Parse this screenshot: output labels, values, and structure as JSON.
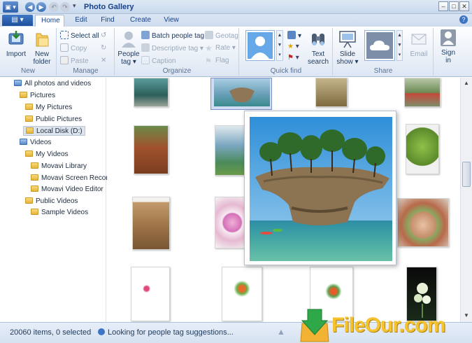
{
  "window": {
    "title": "Photo Gallery"
  },
  "tabs": [
    {
      "label": "Home",
      "active": true
    },
    {
      "label": "Edit"
    },
    {
      "label": "Find"
    },
    {
      "label": "Create"
    },
    {
      "label": "View"
    }
  ],
  "ribbon": {
    "new": {
      "import": "Import",
      "new_folder_1": "New",
      "new_folder_2": "folder",
      "label": "New"
    },
    "manage": {
      "select_all": "Select all",
      "copy": "Copy",
      "paste": "Paste",
      "label": "Manage"
    },
    "organize": {
      "people_tag_1": "People",
      "people_tag_2": "tag ▾",
      "batch_people_tag": "Batch people tag",
      "descriptive_tag": "Descriptive tag ▾",
      "caption": "Caption",
      "geotag": "Geotag",
      "rate": "Rate ▾",
      "flag": "Flag",
      "label": "Organize"
    },
    "quickfind": {
      "text_search_1": "Text",
      "text_search_2": "search",
      "label": "Quick find"
    },
    "share": {
      "slide_show_1": "Slide",
      "slide_show_2": "show ▾",
      "email": "Email",
      "label": "Share"
    },
    "signin": {
      "line1": "Sign",
      "line2": "in"
    }
  },
  "nav": [
    {
      "label": "All photos and videos",
      "indent": 0
    },
    {
      "label": "Pictures",
      "indent": 1
    },
    {
      "label": "My Pictures",
      "indent": 2
    },
    {
      "label": "Public Pictures",
      "indent": 2
    },
    {
      "label": "Local Disk (D:)",
      "indent": 2,
      "selected": true
    },
    {
      "label": "Videos",
      "indent": 1
    },
    {
      "label": "My Videos",
      "indent": 2
    },
    {
      "label": "Movavi Library",
      "indent": 3
    },
    {
      "label": "Movavi Screen Recorde",
      "indent": 3
    },
    {
      "label": "Movavi Video Editor",
      "indent": 3
    },
    {
      "label": "Public Videos",
      "indent": 2
    },
    {
      "label": "Sample Videos",
      "indent": 3
    }
  ],
  "status": {
    "count": "20060 items, 0 selected",
    "message": "Looking for people tag suggestions..."
  },
  "watermark": {
    "text": "FileOur.com"
  },
  "colors": {
    "accent": "#1d4f9c",
    "ribbon_bg": "#e8eef7",
    "selection": "#dde4ee"
  }
}
